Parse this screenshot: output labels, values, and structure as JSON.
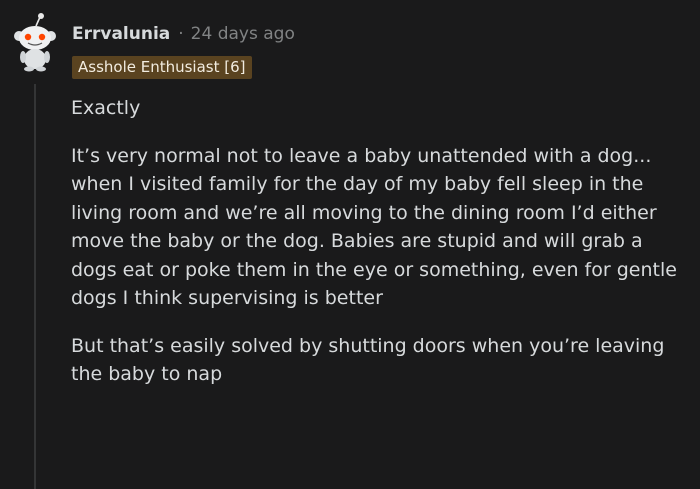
{
  "comment": {
    "author": "Errvalunia",
    "separator": "·",
    "timestamp": "24 days ago",
    "flair": "Asshole Enthusiast [6]",
    "avatar_icon": "snoo-avatar-icon",
    "paragraphs": [
      "Exactly",
      "It’s very normal not to leave a baby unattended with a dog... when I visited family for the day of my baby fell sleep in the living room and we’re all moving to the dining room I’d either move the baby or the dog. Babies are stupid and will grab a dogs eat or poke them in the eye or something, even for gentle dogs I think supervising is better",
      "But that’s easily solved by shutting doors when you’re leaving the baby to nap"
    ]
  },
  "colors": {
    "background": "#1a1a1b",
    "text": "#d7dadc",
    "muted": "#818384",
    "flair_bg": "#5a4320",
    "thread_line": "#343536"
  }
}
